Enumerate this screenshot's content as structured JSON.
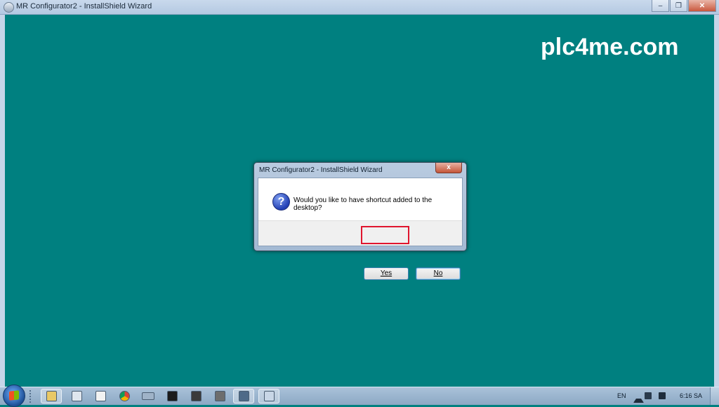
{
  "window": {
    "title": "MR Configurator2 - InstallShield Wizard",
    "controls": [
      "minimize",
      "restore",
      "close"
    ]
  },
  "watermark": "plc4me.com",
  "dialog": {
    "title": "MR Configurator2 - InstallShield Wizard",
    "close_label": "x",
    "icon": "question-icon",
    "message": "Would you like to have shortcut added to the desktop?",
    "yes_label": "Yes",
    "no_label": "No",
    "highlight_color": "#e0152e"
  },
  "taskbar": {
    "items": [
      "explorer-icon",
      "notepad-icon",
      "document-icon",
      "chrome-icon",
      "keyboard-icon",
      "terminal-icon",
      "monitor-icon",
      "tools-icon",
      "network-icon",
      "installer-icon"
    ],
    "language": "EN",
    "clock": "6:16 SA"
  },
  "colors": {
    "desktop": "#008080",
    "accent": "#3c7fb1"
  }
}
